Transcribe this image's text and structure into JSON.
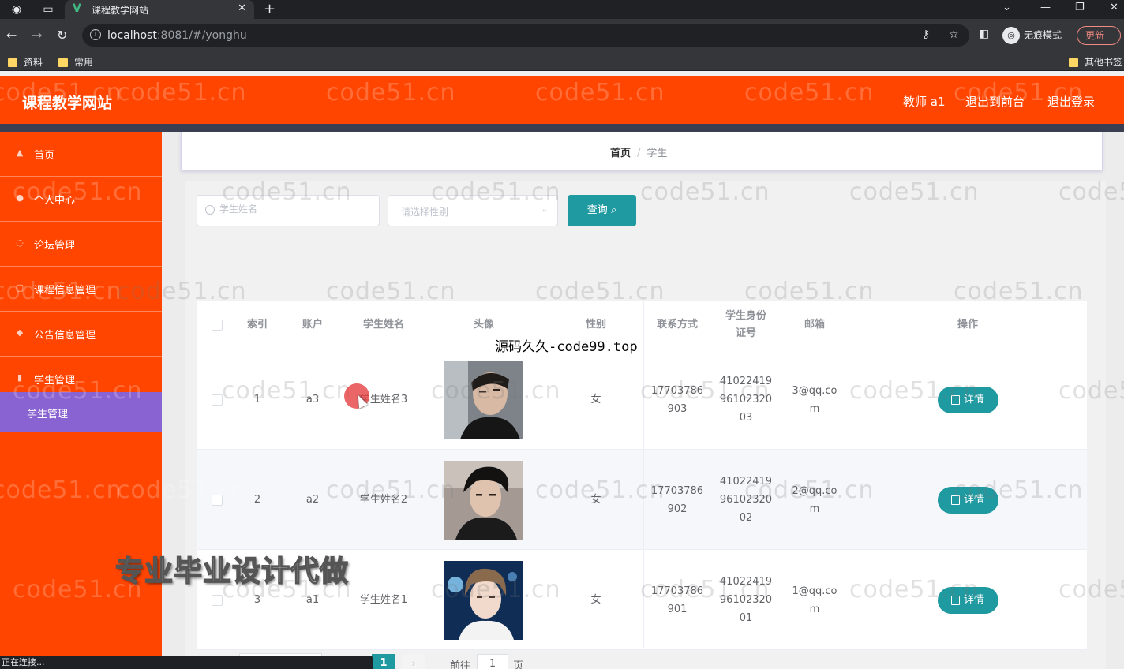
{
  "browser": {
    "tab_title": "课程教学网站",
    "url_host": "localhost",
    "url_rest": ":8081/#/yonghu",
    "incognito_label": "无痕模式",
    "update_label": "更新",
    "bookmarks": [
      "资料",
      "常用"
    ],
    "other_bookmarks": "其他书签",
    "status_text": "正在连接..."
  },
  "header": {
    "brand": "课程教学网站",
    "user_label": "教师 a1",
    "front_link": "退出到前台",
    "logout_link": "退出登录"
  },
  "sidebar": {
    "items": [
      {
        "label": "首页",
        "icon": "home-icon"
      },
      {
        "label": "个人中心",
        "icon": "user-icon"
      },
      {
        "label": "论坛管理",
        "icon": "forum-icon"
      },
      {
        "label": "课程信息管理",
        "icon": "course-icon"
      },
      {
        "label": "公告信息管理",
        "icon": "notice-icon"
      },
      {
        "label": "学生管理",
        "icon": "chart-icon"
      }
    ],
    "sub_item": "学生管理"
  },
  "breadcrumb": {
    "home": "首页",
    "current": "学生"
  },
  "search": {
    "name_placeholder": "学生姓名",
    "gender_placeholder": "请选择性别",
    "query_label": "查询"
  },
  "table": {
    "headers": {
      "index": "索引",
      "account": "账户",
      "name": "学生姓名",
      "avatar": "头像",
      "gender": "性别",
      "phone": "联系方式",
      "idcard_l1": "学生身份",
      "idcard_l2": "证号",
      "email": "邮箱",
      "action": "操作"
    },
    "rows": [
      {
        "index": "1",
        "account": "a3",
        "name": "学生姓名3",
        "gender": "女",
        "phone_l1": "17703786",
        "phone_l2": "903",
        "id_l1": "41022419",
        "id_l2": "96102320",
        "id_l3": "03",
        "email_l1": "3@qq.co",
        "email_l2": "m",
        "action": "详情"
      },
      {
        "index": "2",
        "account": "a2",
        "name": "学生姓名2",
        "gender": "女",
        "phone_l1": "17703786",
        "phone_l2": "902",
        "id_l1": "41022419",
        "id_l2": "96102320",
        "id_l3": "02",
        "email_l1": "2@qq.co",
        "email_l2": "m",
        "action": "详情"
      },
      {
        "index": "3",
        "account": "a1",
        "name": "学生姓名1",
        "gender": "女",
        "phone_l1": "17703786",
        "phone_l2": "901",
        "id_l1": "41022419",
        "id_l2": "96102320",
        "id_l3": "01",
        "email_l1": "1@qq.co",
        "email_l2": "m",
        "action": "详情"
      }
    ]
  },
  "pagination": {
    "current_page": "1",
    "next": "›",
    "goto_label": "前往",
    "goto_value": "1",
    "page_suffix": "页"
  },
  "overlays": {
    "watermark": "code51.cn",
    "source_mark": "源码久久-code99.top",
    "ad_text": "专业毕业设计代做"
  },
  "colors": {
    "accent": "#ff4500",
    "primary": "#1e9aa0",
    "submenu": "#8a63d2"
  }
}
